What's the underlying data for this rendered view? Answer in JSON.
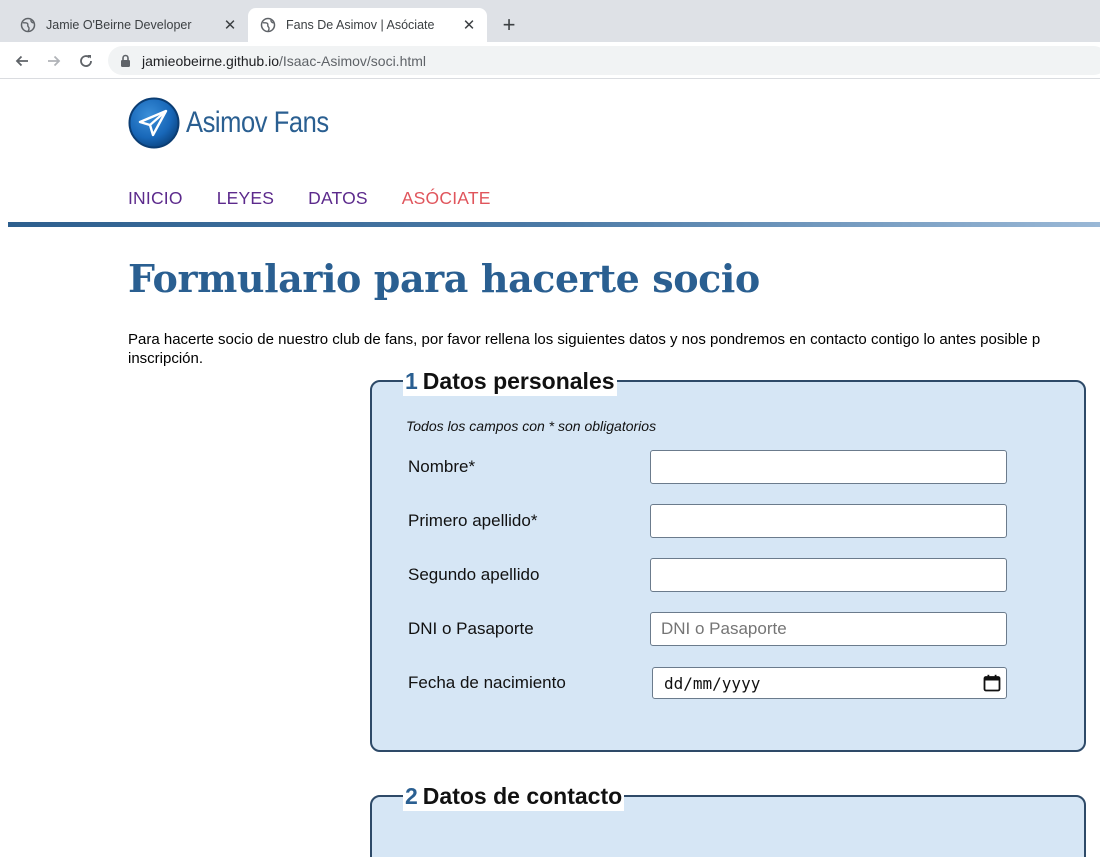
{
  "browser": {
    "tabs": [
      {
        "title": "Jamie O'Beirne Developer",
        "active": false
      },
      {
        "title": "Fans De Asimov | Asóciate",
        "active": true
      }
    ],
    "url_host": "jamieobeirne.github.io",
    "url_path": "/Isaac-Asimov/soci.html"
  },
  "site": {
    "logo_text": "Asimov Fans",
    "brand_color": "#2a5f91",
    "nav": [
      {
        "label": "INICIO",
        "active": false
      },
      {
        "label": "LEYES",
        "active": false
      },
      {
        "label": "DATOS",
        "active": false
      },
      {
        "label": "ASÓCIATE",
        "active": true
      }
    ]
  },
  "main": {
    "title": "Formulario para hacerte socio",
    "intro_line1": "Para hacerte socio de nuestro club de fans, por favor rellena los siguientes datos y nos pondremos en contacto contigo lo antes posible p",
    "intro_line2": "inscripción.",
    "section1": {
      "number": "1",
      "title": "Datos personales",
      "note": "Todos los campos con * son obligatorios",
      "fields": [
        {
          "label": "Nombre*",
          "value": "",
          "placeholder": ""
        },
        {
          "label": "Primero apellido*",
          "value": "",
          "placeholder": ""
        },
        {
          "label": "Segundo apellido",
          "value": "",
          "placeholder": ""
        },
        {
          "label": "DNI o Pasaporte",
          "value": "",
          "placeholder": "DNI o Pasaporte"
        },
        {
          "label": "Fecha de nacimiento",
          "value": "",
          "placeholder": "dd/mm/yyyy"
        }
      ]
    },
    "section2": {
      "number": "2",
      "title": "Datos de contacto"
    }
  }
}
